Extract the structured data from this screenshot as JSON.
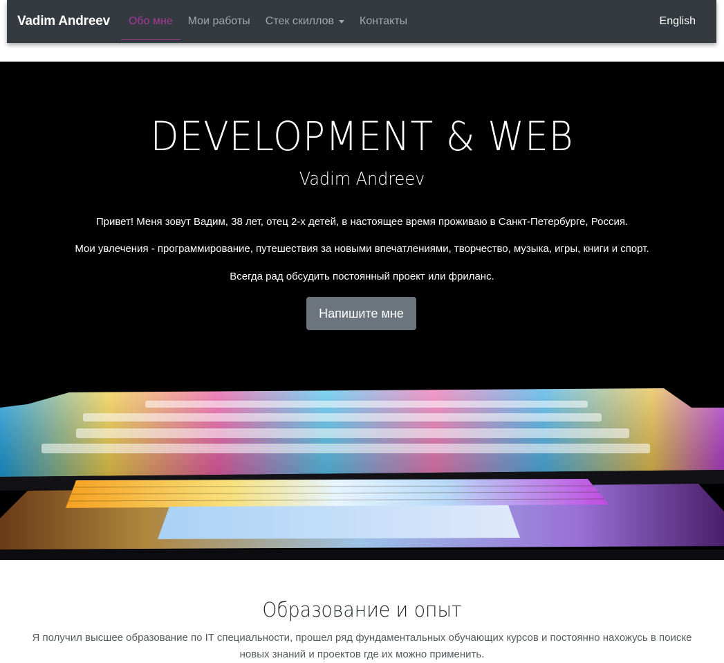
{
  "navbar": {
    "brand": "Vadim Andreev",
    "links": [
      {
        "label": "Обо мне",
        "active": true
      },
      {
        "label": "Мои работы",
        "active": false
      },
      {
        "label": "Стек скиллов",
        "active": false,
        "dropdown": true
      },
      {
        "label": "Контакты",
        "active": false
      }
    ],
    "language": "English",
    "active_color": "#a63a9a"
  },
  "hero": {
    "title": "DEVELOPMENT & WEB",
    "subtitle": "Vadim Andreev",
    "paragraphs": [
      "Привет! Меня зовут Вадим, 38 лет, отец 2-х детей, в настоящее время проживаю в Санкт-Петербурге, Россия.",
      "Мои увлечения - программирование, путешествия за новыми впечатлениями, творчество, музыка, игры, книги и спорт.",
      "Всегда рад обсудить постоянный проект или фриланс."
    ],
    "cta_label": "Напишите мне"
  },
  "education": {
    "title": "Образование и опыт",
    "text": "Я получил высшее образование по IT специальности, прошел ряд фундаментальных обучающих курсов и постоянно нахожусь в поиске новых знаний и проектов где их можно применить."
  }
}
